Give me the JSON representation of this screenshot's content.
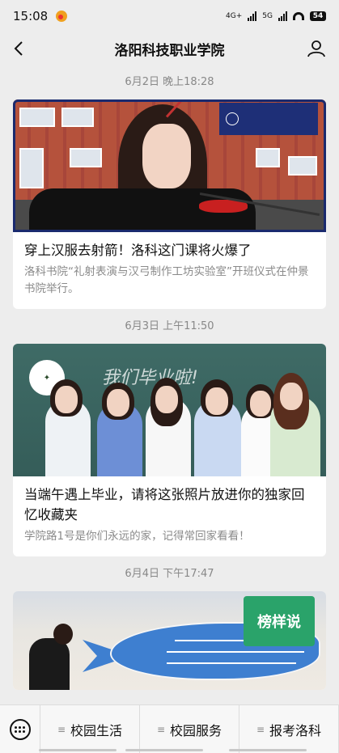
{
  "status_bar": {
    "time": "15:08",
    "network": "4G+",
    "network2": "5G",
    "battery": "54"
  },
  "nav": {
    "title": "洛阳科技职业学院"
  },
  "feed": [
    {
      "date": "6月2日 晚上18:28",
      "title": "穿上汉服去射箭！洛科这门课将火爆了",
      "desc": "洛科书院“礼射表演与汉弓制作工坊实验室”开班仪式在仲景书院举行。"
    },
    {
      "date": "6月3日 上午11:50",
      "title": "当端午遇上毕业，请将这张照片放进你的独家回忆收藏夹",
      "desc": "学院路1号是你们永远的家，记得常回家看看！"
    },
    {
      "date": "6月4日 下午17:47",
      "title": "",
      "desc": ""
    }
  ],
  "images": {
    "img2_chalk": "我们毕业啦!",
    "img3_sign": "榜样说"
  },
  "menu": {
    "items": [
      "校园生活",
      "校园服务",
      "报考洛科"
    ]
  },
  "colors": {
    "background": "#ededed",
    "card": "#ffffff",
    "muted_text": "#8a8a8a"
  }
}
